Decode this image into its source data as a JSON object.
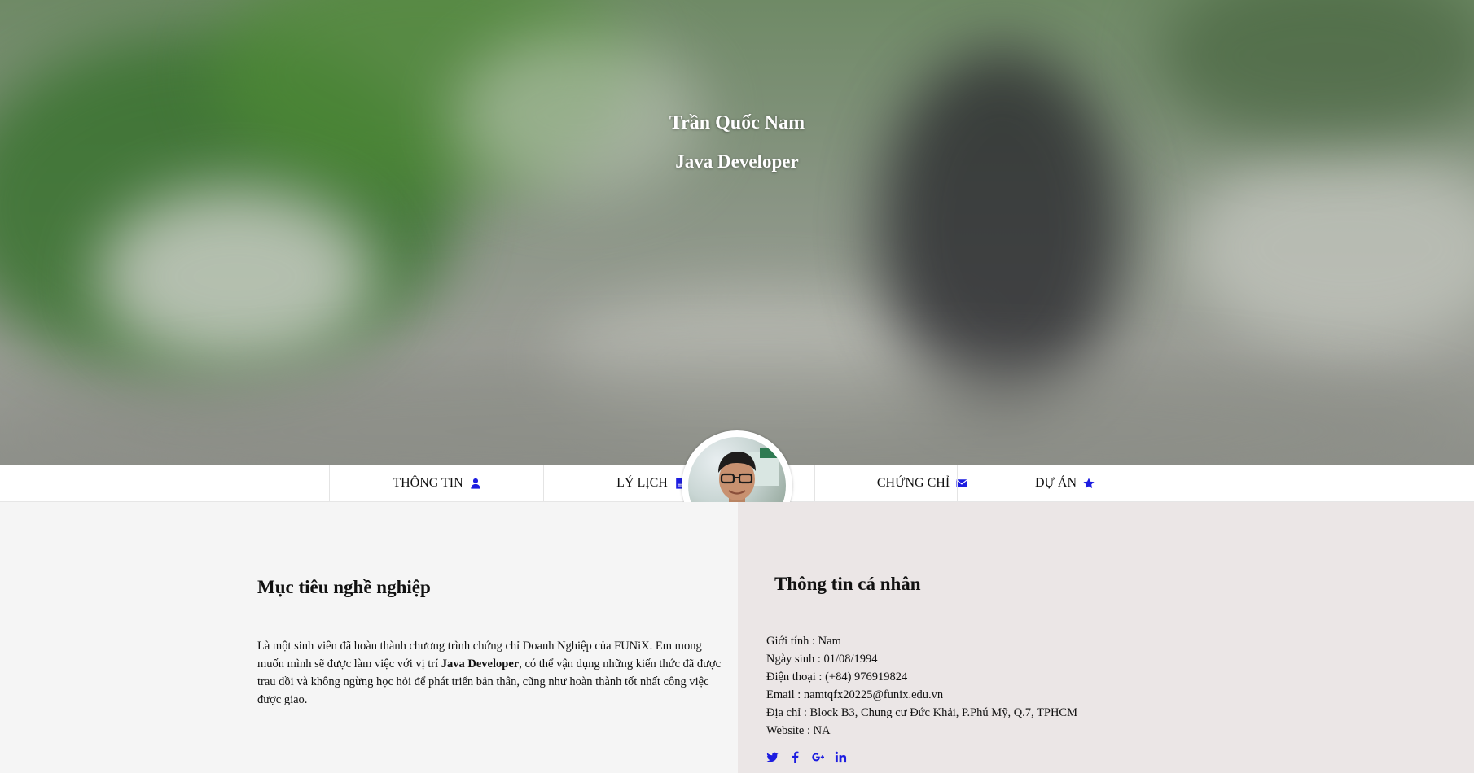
{
  "hero": {
    "name": "Trần Quốc Nam",
    "role": "Java Developer"
  },
  "nav": {
    "items": [
      {
        "label": "THÔNG TIN",
        "icon": "user-icon"
      },
      {
        "label": "LÝ LỊCH",
        "icon": "file-icon"
      },
      {
        "label": "CHỨNG CHỈ",
        "icon": "envelope-icon"
      },
      {
        "label": "DỰ ÁN",
        "icon": "star-icon"
      }
    ],
    "icon_color": "#1d1de0"
  },
  "career": {
    "title": "Mục tiêu nghề nghiệp",
    "text_before": "Là một sinh viên đã hoàn thành chương trình chứng chỉ Doanh Nghiệp của FUNiX. Em mong muốn mình sẽ được làm việc với vị trí ",
    "text_bold": "Java Developer",
    "text_after": ", có thể vận dụng những kiến thức đã được trau dồi và không ngừng học hỏi để phát triển bản thân, cũng như hoàn thành tốt nhất công việc được giao."
  },
  "info": {
    "title": "Thông tin cá nhân",
    "gender": "Giới tính : Nam",
    "birthday": "Ngày sinh : 01/08/1994",
    "phone": "Điện thoại : (+84) 976919824",
    "email": "Email : namtqfx20225@funix.edu.vn",
    "address": "Địa chỉ : Block B3, Chung cư Đức Khải, P.Phú Mỹ, Q.7, TPHCM",
    "website": "Website : NA"
  },
  "social": [
    "twitter-icon",
    "facebook-icon",
    "google-plus-icon",
    "linkedin-icon"
  ],
  "colors": {
    "accent": "#1d1de0",
    "left_bg": "#f5f5f5",
    "right_bg": "#ebe6e6"
  }
}
